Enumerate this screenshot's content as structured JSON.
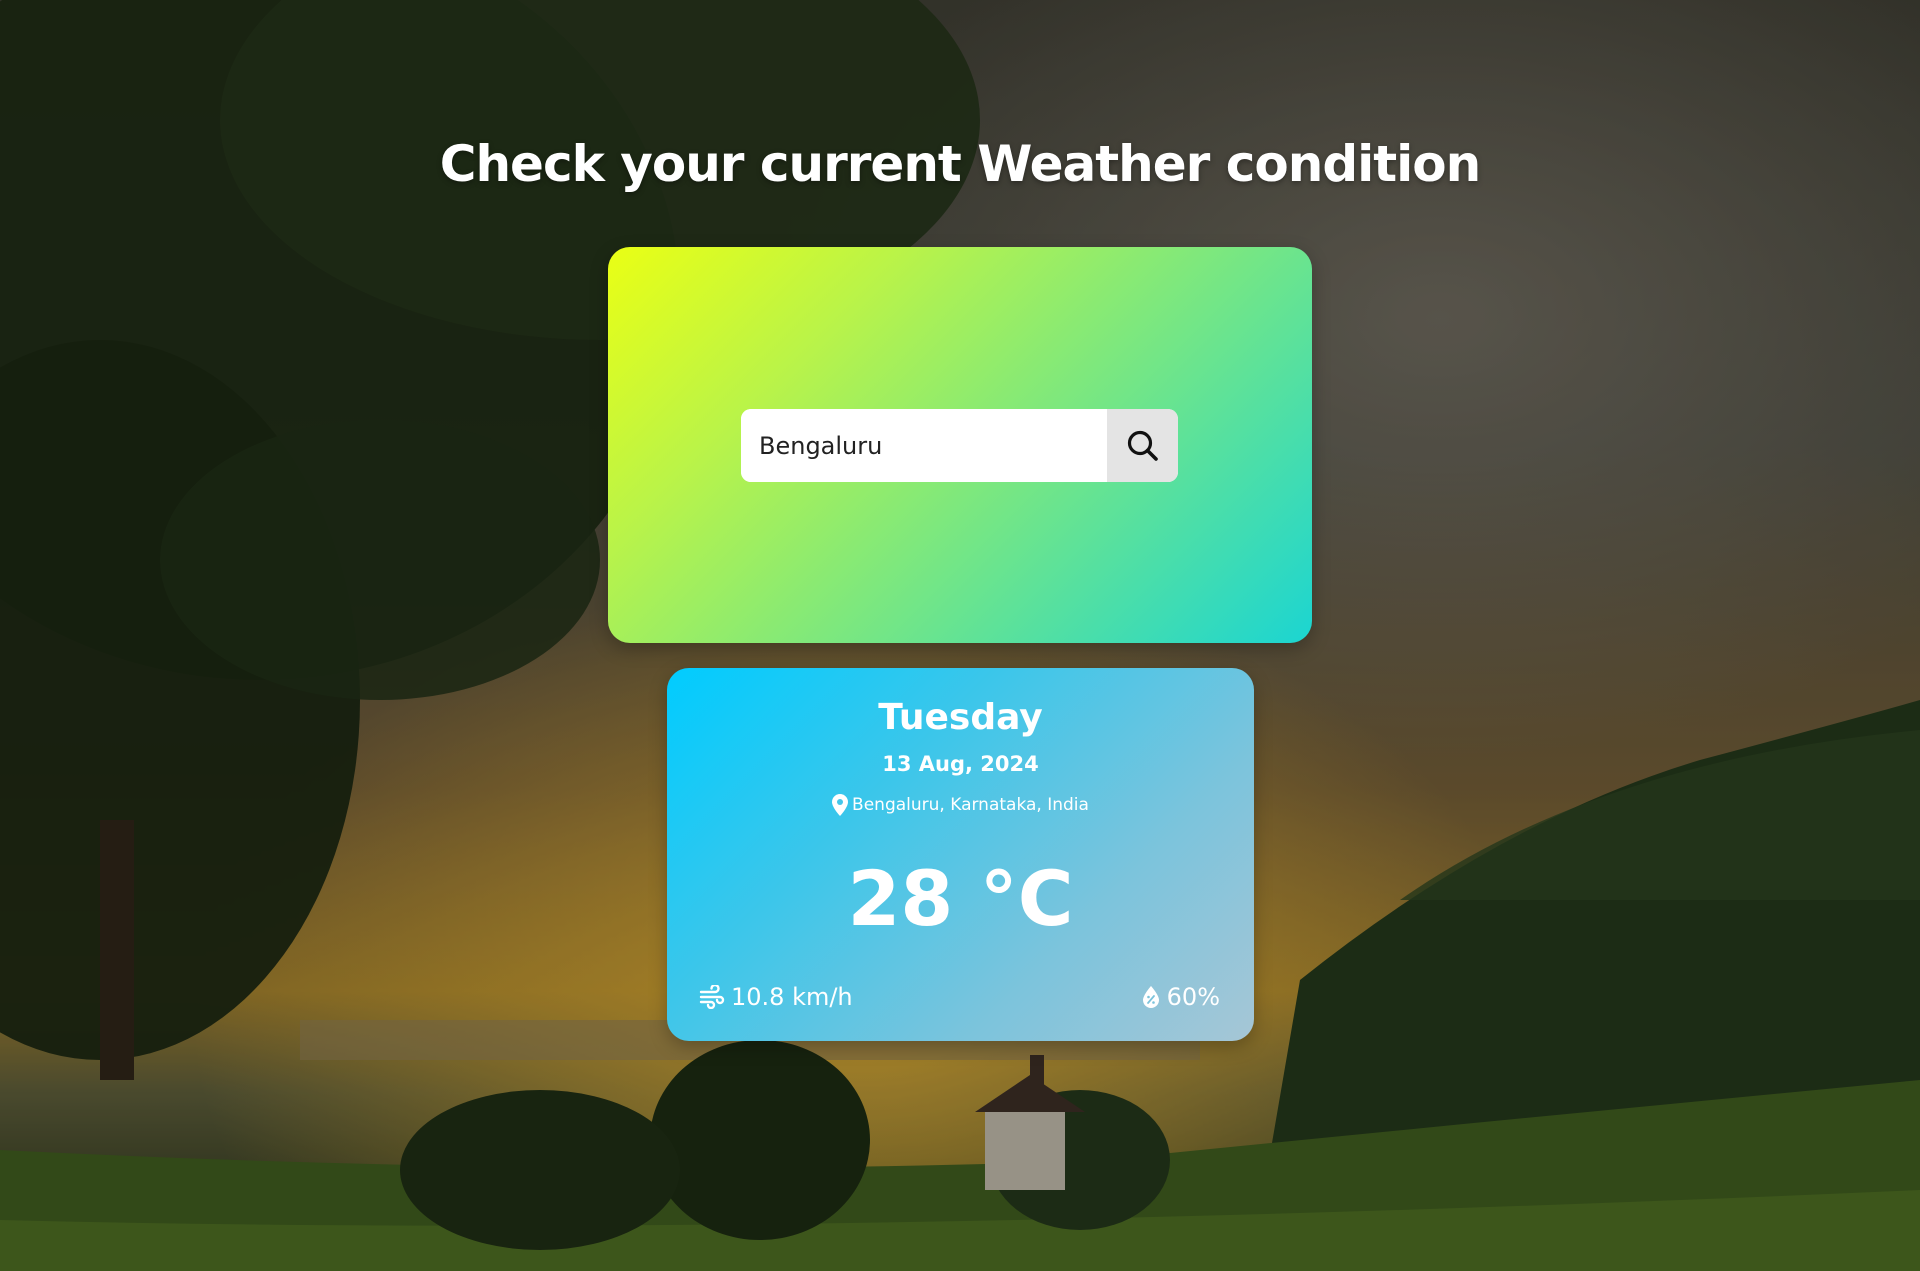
{
  "page": {
    "heading": "Check your current Weather condition"
  },
  "search": {
    "value": "Bengaluru",
    "button_icon": "search-icon"
  },
  "weather": {
    "day": "Tuesday",
    "date": "13 Aug, 2024",
    "location": "Bengaluru, Karnataka, India",
    "location_icon": "map-pin-icon",
    "temperature": "28 °C",
    "wind": "10.8 km/h",
    "wind_icon": "wind-icon",
    "humidity": "60%",
    "humidity_icon": "humidity-drop-icon"
  },
  "colors": {
    "search_card_gradient": [
      "#eaff14",
      "#b8f34a",
      "#6fe58a",
      "#1bd5d2"
    ],
    "weather_card_gradient": [
      "#00ccff",
      "#3cc6ea",
      "#7cc4dc",
      "#a6c6d6"
    ],
    "text": "#ffffff"
  }
}
